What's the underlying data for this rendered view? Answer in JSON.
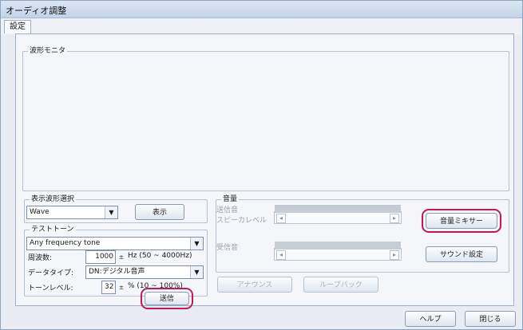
{
  "window": {
    "title": "オーディオ調整"
  },
  "tabs": [
    {
      "label": "設定"
    }
  ],
  "monitor": {
    "label": "波形モニタ"
  },
  "waveform_select": {
    "label": "表示波形選択",
    "value": "Wave",
    "show_button": "表示"
  },
  "test_tone": {
    "label": "テストトーン",
    "tone_value": "Any frequency tone",
    "freq_label": "周波数:",
    "freq_value": "1000",
    "freq_range": "Hz (50 ~ 4000Hz)",
    "datatype_label": "データタイプ:",
    "datatype_value": "DN:デジタル音声",
    "level_label": "トーンレベル:",
    "level_value": "32",
    "level_range": "% (10 ~ 100%)",
    "send_button": "送信"
  },
  "volume": {
    "label": "音量",
    "send_label": "送信音",
    "speaker_label": "スピーカレベル",
    "receive_label": "受信音",
    "mixer_button": "音量ミキサー",
    "sound_settings_button": "サウンド設定",
    "announce_button": "アナウンス",
    "loopback_button": "ループバック"
  },
  "footer": {
    "help_button": "ヘルプ",
    "close_button": "閉じる"
  },
  "icons": {
    "dropdown": "chevron-down-icon",
    "scroll_left": "arrow-left-icon",
    "scroll_right": "arrow-right-icon",
    "spinner": "spinner-icon"
  },
  "colors": {
    "highlight": "#c2185b",
    "window_bg": "#e9edf3"
  }
}
